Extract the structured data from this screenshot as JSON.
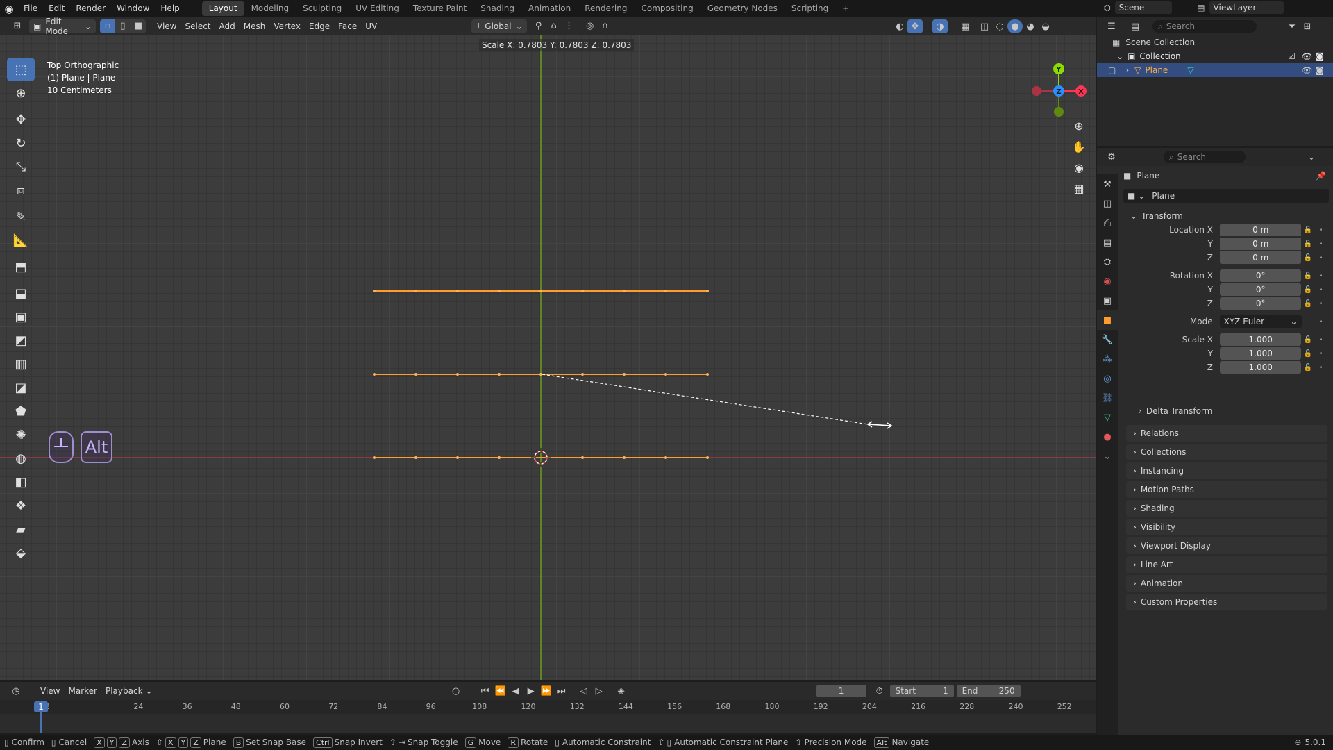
{
  "menu": {
    "file": "File",
    "edit": "Edit",
    "render": "Render",
    "window": "Window",
    "help": "Help"
  },
  "workspaces": [
    "Layout",
    "Modeling",
    "Sculpting",
    "UV Editing",
    "Texture Paint",
    "Shading",
    "Animation",
    "Rendering",
    "Compositing",
    "Geometry Nodes",
    "Scripting"
  ],
  "workspace_add": "+",
  "scene": {
    "label": "Scene",
    "viewlayer": "ViewLayer"
  },
  "vp_header": {
    "mode": "Edit Mode",
    "view": "View",
    "select": "Select",
    "add": "Add",
    "mesh": "Mesh",
    "vertex": "Vertex",
    "edge": "Edge",
    "face": "Face",
    "uv": "UV",
    "orientation": "Global"
  },
  "viewport": {
    "view_name": "Top Orthographic",
    "object_info": "(1) Plane | Plane",
    "scale_info": "10 Centimeters",
    "scale_readout": "Scale X: 0.7803   Y: 0.7803   Z: 0.7803"
  },
  "gizmo": {
    "x": "X",
    "y": "Y",
    "z": "Z"
  },
  "key_overlay": {
    "alt": "Alt"
  },
  "timeline": {
    "view": "View",
    "marker": "Marker",
    "playback": "Playback",
    "current_frame": "1",
    "start_label": "Start",
    "start": "1",
    "end_label": "End",
    "end": "250",
    "ticks": [
      "1",
      "12",
      "24",
      "36",
      "48",
      "60",
      "72",
      "84",
      "96",
      "108",
      "120",
      "132",
      "144",
      "156",
      "168",
      "180",
      "192",
      "204",
      "216",
      "228",
      "240",
      "252"
    ]
  },
  "status": {
    "confirm": "Confirm",
    "cancel": "Cancel",
    "axis": "Axis",
    "plane": "Plane",
    "set_snap_base": "Set Snap Base",
    "snap_invert": "Snap Invert",
    "snap_toggle": "Snap Toggle",
    "move": "Move",
    "rotate": "Rotate",
    "auto_constraint": "Automatic Constraint",
    "auto_constraint_plane": "Automatic Constraint Plane",
    "precision": "Precision Mode",
    "navigate": "Navigate",
    "version": "5.0.1",
    "keys": {
      "x": "X",
      "y": "Y",
      "z": "Z",
      "b": "B",
      "ctrl": "Ctrl",
      "g": "G",
      "r": "R",
      "alt": "Alt"
    }
  },
  "outliner": {
    "search_placeholder": "Search",
    "scene_collection": "Scene Collection",
    "collection": "Collection",
    "plane": "Plane"
  },
  "properties": {
    "search_placeholder": "Search",
    "object_name": "Plane",
    "data_name": "Plane",
    "transform": "Transform",
    "location_x": "Location X",
    "rotation_x": "Rotation X",
    "scale_x": "Scale X",
    "y": "Y",
    "z": "Z",
    "mode_label": "Mode",
    "mode_value": "XYZ Euler",
    "loc": [
      "0 m",
      "0 m",
      "0 m"
    ],
    "rot": [
      "0°",
      "0°",
      "0°"
    ],
    "scale": [
      "1.000",
      "1.000",
      "1.000"
    ],
    "delta": "Delta Transform",
    "panels": [
      "Relations",
      "Collections",
      "Instancing",
      "Motion Paths",
      "Shading",
      "Visibility",
      "Viewport Display",
      "Line Art",
      "Animation",
      "Custom Properties"
    ]
  },
  "colors": {
    "accent": "#4772b3",
    "selected_edge": "#ff9c2b",
    "x_axis": "#ff3352",
    "y_axis": "#8bdc00",
    "z_axis": "#2890ff"
  }
}
